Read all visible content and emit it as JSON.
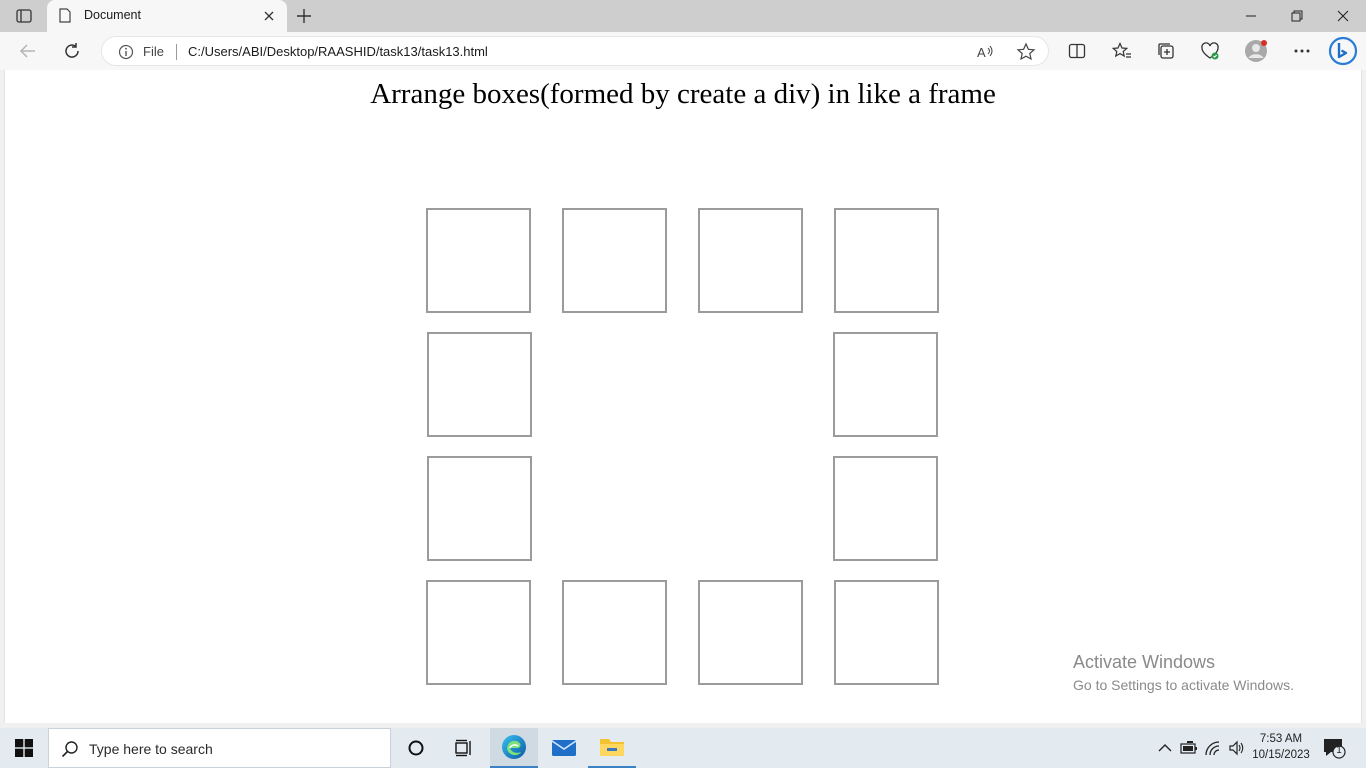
{
  "browser": {
    "tab_title": "Document",
    "address_scheme": "File",
    "address_url": "C:/Users/ABI/Desktop/RAASHID/task13/task13.html"
  },
  "page": {
    "heading": "Arrange boxes(formed by create a div) in like a frame",
    "box_color": "#9b9b9b"
  },
  "watermark": {
    "title": "Activate Windows",
    "subtitle": "Go to Settings to activate Windows."
  },
  "taskbar": {
    "search_placeholder": "Type here to search",
    "time": "7:53 AM",
    "date": "10/15/2023",
    "notification_count": "1",
    "apps": [
      "cortana-icon",
      "task-view-icon",
      "edge-icon",
      "mail-icon",
      "file-explorer-icon"
    ]
  }
}
